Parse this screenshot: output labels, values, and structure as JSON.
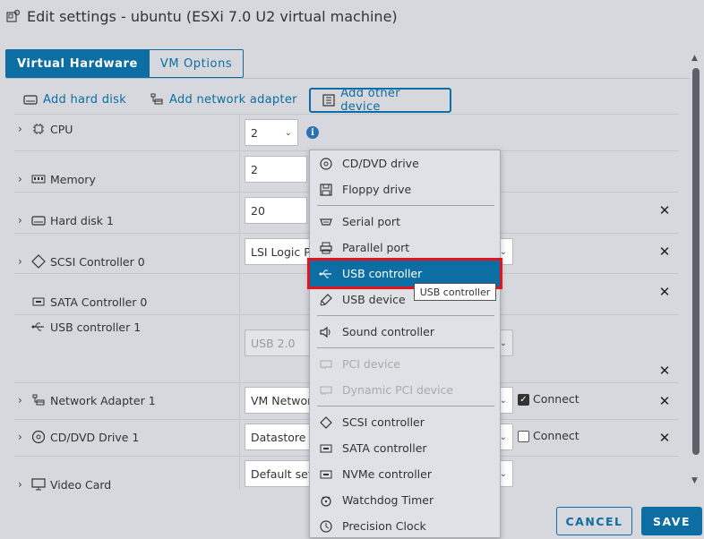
{
  "dialog": {
    "title": "Edit settings - ubuntu (ESXi 7.0 U2 virtual machine)",
    "title_icon": "vm-settings-icon"
  },
  "tabs": [
    {
      "label": "Virtual Hardware",
      "active": true
    },
    {
      "label": "VM Options",
      "active": false
    }
  ],
  "toolbar": {
    "add_hard_disk": "Add hard disk",
    "add_network_adapter": "Add network adapter",
    "add_other_device": "Add other device"
  },
  "rows": {
    "cpu": {
      "label": "CPU",
      "value": "2"
    },
    "memory": {
      "label": "Memory",
      "value": "2"
    },
    "hard_disk": {
      "label": "Hard disk 1",
      "value": "20"
    },
    "scsi": {
      "label": "SCSI Controller 0",
      "value": "LSI Logic Pa"
    },
    "sata": {
      "label": "SATA Controller 0"
    },
    "usb": {
      "label": "USB controller 1",
      "value": "USB 2.0"
    },
    "network": {
      "label": "Network Adapter 1",
      "value": "VM Networ",
      "connect_label": "Connect",
      "connected": true
    },
    "cddvd": {
      "label": "CD/DVD Drive 1",
      "value": "Datastore IS",
      "connect_label": "Connect",
      "connected": false
    },
    "video": {
      "label": "Video Card",
      "value": "Default setti"
    }
  },
  "menu": {
    "items": [
      {
        "label": "CD/DVD drive",
        "icon": "disc-icon",
        "enabled": true
      },
      {
        "label": "Floppy drive",
        "icon": "floppy-icon",
        "enabled": true
      },
      {
        "label": "Serial port",
        "icon": "serial-port-icon",
        "enabled": true
      },
      {
        "label": "Parallel port",
        "icon": "printer-icon",
        "enabled": true
      },
      {
        "label": "USB controller",
        "icon": "usb-icon",
        "enabled": true,
        "selected": true
      },
      {
        "label": "USB device",
        "icon": "usb-drive-icon",
        "enabled": true
      },
      {
        "label": "Sound controller",
        "icon": "speaker-icon",
        "enabled": true
      },
      {
        "label": "PCI device",
        "icon": "pci-card-icon",
        "enabled": false
      },
      {
        "label": "Dynamic PCI device",
        "icon": "pci-card-icon",
        "enabled": false
      },
      {
        "label": "SCSI controller",
        "icon": "scsi-icon",
        "enabled": true
      },
      {
        "label": "SATA controller",
        "icon": "sata-icon",
        "enabled": true
      },
      {
        "label": "NVMe controller",
        "icon": "nvme-icon",
        "enabled": true
      },
      {
        "label": "Watchdog Timer",
        "icon": "watchdog-icon",
        "enabled": true
      },
      {
        "label": "Precision Clock",
        "icon": "clock-icon",
        "enabled": true
      }
    ],
    "tooltip": "USB controller"
  },
  "footer": {
    "cancel": "CANCEL",
    "save": "SAVE"
  },
  "colors": {
    "accent": "#0c6ea3",
    "highlight_border": "#e2141d",
    "background": "#d6d8dd"
  }
}
